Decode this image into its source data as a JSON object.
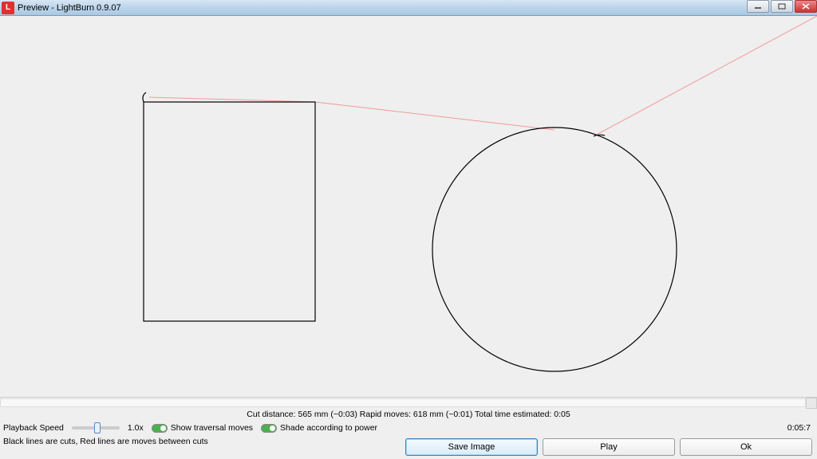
{
  "window": {
    "title": "Preview - LightBurn 0.9.07",
    "icon_letter": "L"
  },
  "stats": {
    "text": "Cut distance: 565 mm (~0:03)   Rapid moves: 618 mm (~0:01)   Total time estimated: 0:05"
  },
  "controls": {
    "playback_label": "Playback Speed",
    "playback_value": "1.0x",
    "show_traversal_label": "Show traversal moves",
    "shade_power_label": "Shade according to power",
    "time_display": "0:05:7"
  },
  "hint": {
    "text": "Black lines are cuts, Red lines are moves between cuts"
  },
  "buttons": {
    "save_image": "Save Image",
    "play": "Play",
    "ok": "Ok"
  }
}
